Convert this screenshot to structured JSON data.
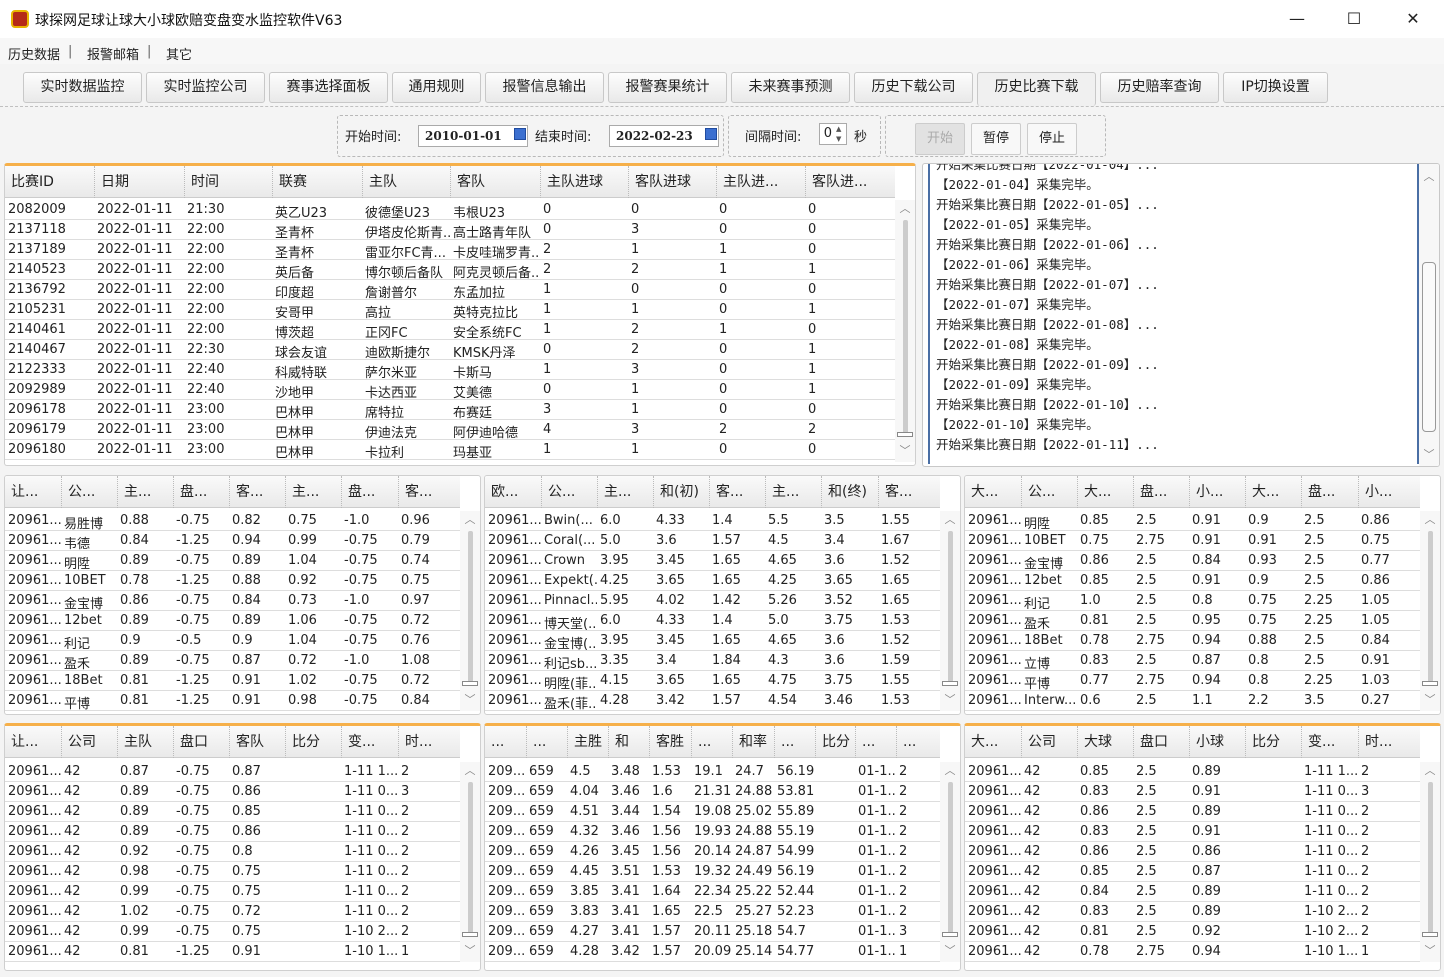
{
  "window": {
    "title": "球探网足球让球大小球欧赔变盘变水监控软件V63",
    "minimize": "—",
    "maximize": "☐",
    "close": "✕"
  },
  "menu": [
    "历史数据",
    "报警邮箱",
    "其它"
  ],
  "tabs": [
    {
      "label": "实时数据监控"
    },
    {
      "label": "实时监控公司"
    },
    {
      "label": "赛事选择面板"
    },
    {
      "label": "通用规则"
    },
    {
      "label": "报警信息输出"
    },
    {
      "label": "报警赛果统计"
    },
    {
      "label": "未来赛事预测"
    },
    {
      "label": "历史下载公司"
    },
    {
      "label": "历史比赛下载",
      "active": true
    },
    {
      "label": "历史赔率查询"
    },
    {
      "label": "IP切换设置"
    }
  ],
  "controls": {
    "start_label": "开始时间:",
    "start_value": "2010-01-01",
    "end_label": "结束时间:",
    "end_value": "2022-02-23",
    "interval_label": "间隔时间:",
    "interval_value": "0",
    "interval_unit": "秒",
    "btn_start": "开始",
    "btn_pause": "暂停",
    "btn_stop": "停止"
  },
  "main_table": {
    "columns": [
      "比赛ID",
      "日期",
      "时间",
      "联赛",
      "主队",
      "客队",
      "主队进球",
      "客队进球",
      "主队进...",
      "客队进..."
    ],
    "rows": [
      [
        "2082009",
        "2022-01-11",
        "21:30",
        "英乙U23",
        "彼德堡U23",
        "韦根U23",
        "0",
        "0",
        "0",
        "0"
      ],
      [
        "2137118",
        "2022-01-11",
        "22:00",
        "圣青杯",
        "伊塔皮伦斯青...",
        "高士路青年队",
        "0",
        "3",
        "0",
        "0"
      ],
      [
        "2137189",
        "2022-01-11",
        "22:00",
        "圣青杯",
        "雷亚尔FC青...",
        "卡皮哇瑞罗青...",
        "2",
        "1",
        "1",
        "0"
      ],
      [
        "2140523",
        "2022-01-11",
        "22:00",
        "英后备",
        "博尔顿后备队",
        "阿克灵顿后备...",
        "2",
        "2",
        "1",
        "1"
      ],
      [
        "2136792",
        "2022-01-11",
        "22:00",
        "印度超",
        "詹谢普尔",
        "东孟加拉",
        "1",
        "0",
        "0",
        "0"
      ],
      [
        "2105231",
        "2022-01-11",
        "22:00",
        "安哥甲",
        "高拉",
        "英特克拉比",
        "1",
        "1",
        "0",
        "1"
      ],
      [
        "2140461",
        "2022-01-11",
        "22:00",
        "博茨超",
        "正冈FC",
        "安全系统FC",
        "1",
        "2",
        "1",
        "0"
      ],
      [
        "2140467",
        "2022-01-11",
        "22:30",
        "球会友谊",
        "迪欧斯捷尔",
        "KMSK丹泽",
        "0",
        "2",
        "0",
        "1"
      ],
      [
        "2122333",
        "2022-01-11",
        "22:40",
        "科威特联",
        "萨尔米亚",
        "卡斯马",
        "1",
        "3",
        "0",
        "1"
      ],
      [
        "2092989",
        "2022-01-11",
        "22:40",
        "沙地甲",
        "卡达西亚",
        "艾美德",
        "0",
        "1",
        "0",
        "1"
      ],
      [
        "2096178",
        "2022-01-11",
        "23:00",
        "巴林甲",
        "席特拉",
        "布赛廷",
        "3",
        "1",
        "0",
        "0"
      ],
      [
        "2096179",
        "2022-01-11",
        "23:00",
        "巴林甲",
        "伊迪法克",
        "阿伊迪哈德",
        "4",
        "3",
        "2",
        "2"
      ],
      [
        "2096180",
        "2022-01-11",
        "23:00",
        "巴林甲",
        "卡拉利",
        "玛基亚",
        "1",
        "1",
        "0",
        "0"
      ]
    ]
  },
  "log": [
    "开始采集比赛日期【2022-01-04】...",
    "【2022-01-04】采集完毕。",
    "开始采集比赛日期【2022-01-05】...",
    "【2022-01-05】采集完毕。",
    "开始采集比赛日期【2022-01-06】...",
    "【2022-01-06】采集完毕。",
    "开始采集比赛日期【2022-01-07】...",
    "【2022-01-07】采集完毕。",
    "开始采集比赛日期【2022-01-08】...",
    "【2022-01-08】采集完毕。",
    "开始采集比赛日期【2022-01-09】...",
    "【2022-01-09】采集完毕。",
    "开始采集比赛日期【2022-01-10】...",
    "【2022-01-10】采集完毕。",
    "开始采集比赛日期【2022-01-11】..."
  ],
  "handicap_table": {
    "columns": [
      "让...",
      "公...",
      "主...",
      "盘...",
      "客...",
      "主...",
      "盘...",
      "客..."
    ],
    "rows": [
      [
        "20961...",
        "易胜博",
        "0.88",
        "-0.75",
        "0.82",
        "0.75",
        "-1.0",
        "0.96"
      ],
      [
        "20961...",
        "韦德",
        "0.84",
        "-1.25",
        "0.94",
        "0.99",
        "-0.75",
        "0.79"
      ],
      [
        "20961...",
        "明陞",
        "0.89",
        "-0.75",
        "0.89",
        "1.04",
        "-0.75",
        "0.74"
      ],
      [
        "20961...",
        "10BET",
        "0.78",
        "-1.25",
        "0.88",
        "0.92",
        "-0.75",
        "0.75"
      ],
      [
        "20961...",
        "金宝博",
        "0.86",
        "-0.75",
        "0.84",
        "0.73",
        "-1.0",
        "0.97"
      ],
      [
        "20961...",
        "12bet",
        "0.89",
        "-0.75",
        "0.89",
        "1.06",
        "-0.75",
        "0.72"
      ],
      [
        "20961...",
        "利记",
        "0.9",
        "-0.5",
        "0.9",
        "1.04",
        "-0.75",
        "0.76"
      ],
      [
        "20961...",
        "盈禾",
        "0.89",
        "-0.75",
        "0.87",
        "0.72",
        "-1.0",
        "1.08"
      ],
      [
        "20961...",
        "18Bet",
        "0.81",
        "-1.25",
        "0.91",
        "1.02",
        "-0.75",
        "0.72"
      ],
      [
        "20961...",
        "平博",
        "0.81",
        "-1.25",
        "0.91",
        "0.98",
        "-0.75",
        "0.84"
      ]
    ]
  },
  "euro_table": {
    "columns": [
      "欧...",
      "公...",
      "主...",
      "和(初)",
      "客...",
      "主...",
      "和(终)",
      "客..."
    ],
    "rows": [
      [
        "20961...",
        "Bwin(...",
        "6.0",
        "4.33",
        "1.4",
        "5.5",
        "3.5",
        "1.55"
      ],
      [
        "20961...",
        "Coral(...",
        "5.0",
        "3.6",
        "1.57",
        "4.5",
        "3.4",
        "1.67"
      ],
      [
        "20961...",
        "Crown",
        "3.95",
        "3.45",
        "1.65",
        "4.65",
        "3.6",
        "1.52"
      ],
      [
        "20961...",
        "Expekt(...",
        "4.25",
        "3.65",
        "1.65",
        "4.25",
        "3.65",
        "1.65"
      ],
      [
        "20961...",
        "Pinnacl...",
        "5.95",
        "4.02",
        "1.42",
        "5.26",
        "3.52",
        "1.65"
      ],
      [
        "20961...",
        "博天堂(...",
        "6.0",
        "4.33",
        "1.4",
        "5.0",
        "3.75",
        "1.53"
      ],
      [
        "20961...",
        "金宝博(...",
        "3.95",
        "3.45",
        "1.65",
        "4.65",
        "3.6",
        "1.52"
      ],
      [
        "20961...",
        "利记sb...",
        "3.35",
        "3.4",
        "1.84",
        "4.3",
        "3.6",
        "1.59"
      ],
      [
        "20961...",
        "明陞(菲...",
        "4.15",
        "3.65",
        "1.65",
        "4.75",
        "3.75",
        "1.55"
      ],
      [
        "20961...",
        "盈禾(菲...",
        "4.28",
        "3.42",
        "1.57",
        "4.54",
        "3.46",
        "1.53"
      ]
    ]
  },
  "overunder_table": {
    "columns": [
      "大...",
      "公...",
      "大...",
      "盘...",
      "小...",
      "大...",
      "盘...",
      "小..."
    ],
    "rows": [
      [
        "20961...",
        "明陞",
        "0.85",
        "2.5",
        "0.91",
        "0.9",
        "2.5",
        "0.86"
      ],
      [
        "20961...",
        "10BET",
        "0.75",
        "2.75",
        "0.91",
        "0.91",
        "2.5",
        "0.75"
      ],
      [
        "20961...",
        "金宝博",
        "0.86",
        "2.5",
        "0.84",
        "0.93",
        "2.5",
        "0.77"
      ],
      [
        "20961...",
        "12bet",
        "0.85",
        "2.5",
        "0.91",
        "0.9",
        "2.5",
        "0.86"
      ],
      [
        "20961...",
        "利记",
        "1.0",
        "2.5",
        "0.8",
        "0.75",
        "2.25",
        "1.05"
      ],
      [
        "20961...",
        "盈禾",
        "0.81",
        "2.5",
        "0.95",
        "0.75",
        "2.25",
        "1.05"
      ],
      [
        "20961...",
        "18Bet",
        "0.78",
        "2.75",
        "0.94",
        "0.88",
        "2.5",
        "0.84"
      ],
      [
        "20961...",
        "立博",
        "0.83",
        "2.5",
        "0.87",
        "0.8",
        "2.5",
        "0.91"
      ],
      [
        "20961...",
        "平博",
        "0.77",
        "2.75",
        "0.94",
        "0.8",
        "2.25",
        "1.03"
      ],
      [
        "20961...",
        "Interw...",
        "0.6",
        "2.5",
        "1.1",
        "2.2",
        "3.5",
        "0.27"
      ]
    ]
  },
  "handicap_detail_table": {
    "columns": [
      "让...",
      "公司",
      "主队",
      "盘口",
      "客队",
      "比分",
      "变...",
      "时..."
    ],
    "rows": [
      [
        "20961...",
        "42",
        "0.87",
        "-0.75",
        "0.87",
        "",
        "1-11 1...",
        "2"
      ],
      [
        "20961...",
        "42",
        "0.89",
        "-0.75",
        "0.86",
        "",
        "1-11 0...",
        "3"
      ],
      [
        "20961...",
        "42",
        "0.89",
        "-0.75",
        "0.85",
        "",
        "1-11 0...",
        "2"
      ],
      [
        "20961...",
        "42",
        "0.89",
        "-0.75",
        "0.86",
        "",
        "1-11 0...",
        "2"
      ],
      [
        "20961...",
        "42",
        "0.92",
        "-0.75",
        "0.8",
        "",
        "1-11 0...",
        "2"
      ],
      [
        "20961...",
        "42",
        "0.98",
        "-0.75",
        "0.75",
        "",
        "1-11 0...",
        "2"
      ],
      [
        "20961...",
        "42",
        "0.99",
        "-0.75",
        "0.75",
        "",
        "1-11 0...",
        "2"
      ],
      [
        "20961...",
        "42",
        "1.02",
        "-0.75",
        "0.72",
        "",
        "1-11 0...",
        "2"
      ],
      [
        "20961...",
        "42",
        "0.99",
        "-0.75",
        "0.75",
        "",
        "1-10 2...",
        "2"
      ],
      [
        "20961...",
        "42",
        "0.81",
        "-1.25",
        "0.91",
        "",
        "1-10 1...",
        "1"
      ]
    ]
  },
  "euro_detail_table": {
    "columns": [
      "...",
      "...",
      "主胜",
      "和",
      "客胜",
      "...",
      "和率",
      "...",
      "比分",
      "...",
      "..."
    ],
    "rows": [
      [
        "209...",
        "659",
        "4.5",
        "3.48",
        "1.53",
        "19.1",
        "24.7",
        "56.19",
        "",
        "01-1...",
        "2"
      ],
      [
        "209...",
        "659",
        "4.04",
        "3.46",
        "1.6",
        "21.31",
        "24.88",
        "53.81",
        "",
        "01-1...",
        "2"
      ],
      [
        "209...",
        "659",
        "4.51",
        "3.44",
        "1.54",
        "19.08",
        "25.02",
        "55.89",
        "",
        "01-1...",
        "2"
      ],
      [
        "209...",
        "659",
        "4.32",
        "3.46",
        "1.56",
        "19.93",
        "24.88",
        "55.19",
        "",
        "01-1...",
        "2"
      ],
      [
        "209...",
        "659",
        "4.26",
        "3.45",
        "1.56",
        "20.14",
        "24.87",
        "54.99",
        "",
        "01-1...",
        "2"
      ],
      [
        "209...",
        "659",
        "4.45",
        "3.51",
        "1.53",
        "19.32",
        "24.49",
        "56.19",
        "",
        "01-1...",
        "2"
      ],
      [
        "209...",
        "659",
        "3.85",
        "3.41",
        "1.64",
        "22.34",
        "25.22",
        "52.44",
        "",
        "01-1...",
        "2"
      ],
      [
        "209...",
        "659",
        "3.83",
        "3.41",
        "1.65",
        "22.5",
        "25.27",
        "52.23",
        "",
        "01-1...",
        "2"
      ],
      [
        "209...",
        "659",
        "4.27",
        "3.41",
        "1.57",
        "20.11",
        "25.18",
        "54.7",
        "",
        "01-1...",
        "3"
      ],
      [
        "209...",
        "659",
        "4.28",
        "3.42",
        "1.57",
        "20.09",
        "25.14",
        "54.77",
        "",
        "01-1...",
        "1"
      ]
    ]
  },
  "overunder_detail_table": {
    "columns": [
      "大...",
      "公司",
      "大球",
      "盘口",
      "小球",
      "比分",
      "变...",
      "时..."
    ],
    "rows": [
      [
        "20961...",
        "42",
        "0.85",
        "2.5",
        "0.89",
        "",
        "1-11 1...",
        "2"
      ],
      [
        "20961...",
        "42",
        "0.83",
        "2.5",
        "0.91",
        "",
        "1-11 0...",
        "3"
      ],
      [
        "20961...",
        "42",
        "0.86",
        "2.5",
        "0.89",
        "",
        "1-11 0...",
        "2"
      ],
      [
        "20961...",
        "42",
        "0.83",
        "2.5",
        "0.91",
        "",
        "1-11 0...",
        "2"
      ],
      [
        "20961...",
        "42",
        "0.86",
        "2.5",
        "0.86",
        "",
        "1-11 0...",
        "2"
      ],
      [
        "20961...",
        "42",
        "0.85",
        "2.5",
        "0.87",
        "",
        "1-11 0...",
        "2"
      ],
      [
        "20961...",
        "42",
        "0.84",
        "2.5",
        "0.89",
        "",
        "1-11 0...",
        "2"
      ],
      [
        "20961...",
        "42",
        "0.83",
        "2.5",
        "0.89",
        "",
        "1-10 2...",
        "2"
      ],
      [
        "20961...",
        "42",
        "0.81",
        "2.5",
        "0.92",
        "",
        "1-10 2...",
        "2"
      ],
      [
        "20961...",
        "42",
        "0.78",
        "2.75",
        "0.94",
        "",
        "1-10 1...",
        "1"
      ]
    ]
  }
}
